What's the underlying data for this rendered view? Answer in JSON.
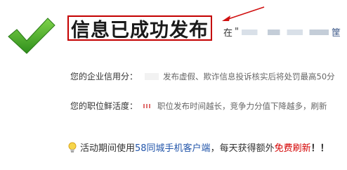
{
  "header": {
    "success_icon": "checkmark-icon",
    "title": "信息已成功发布",
    "subtitle_prefix": "在",
    "subtitle_quote": "\"",
    "subtitle_trail": "筐"
  },
  "stats": {
    "credit_label": "您的企业信用分：",
    "credit_desc": "发布虚假、欺诈信息投诉核实后将处罚最高50分",
    "freshness_label": "您的职位鲜活度：",
    "freshness_desc": "职位发布时间越长，竞争力分值下降越多，刷新"
  },
  "promo": {
    "icon": "lightbulb-icon",
    "text_before": "活动期间使用",
    "link_text": "58同城手机客户端",
    "text_middle": "，每天获得额外",
    "free_text": "免费刷新",
    "exclaim": "！！"
  },
  "colors": {
    "check_green": "#4caf2a",
    "highlight_red": "#c40000",
    "link_blue": "#2255aa",
    "free_red": "#d40000"
  }
}
